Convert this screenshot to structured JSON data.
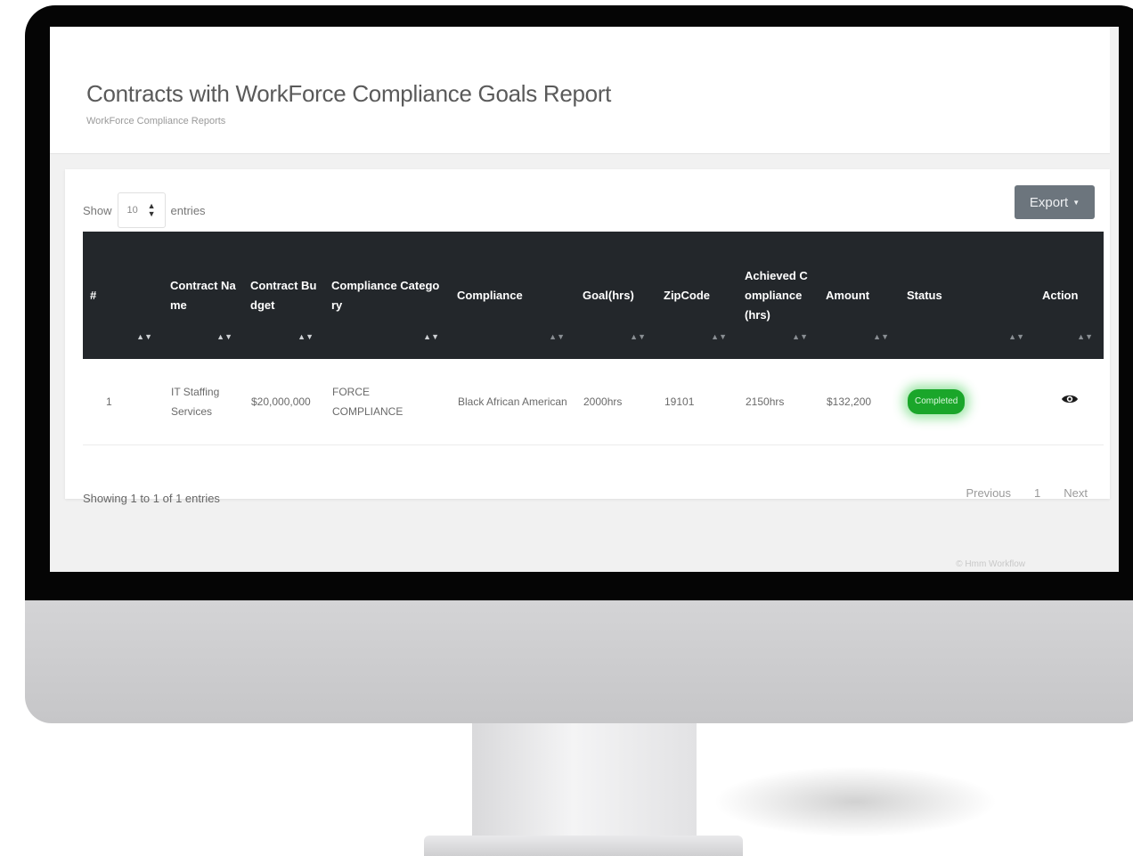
{
  "page": {
    "title": "Contracts with WorkForce Compliance Goals Report",
    "subtitle": "WorkForce Compliance Reports"
  },
  "controls": {
    "show_label": "Show",
    "length_value": "10",
    "entries_label": "entries",
    "export_label": "Export"
  },
  "table": {
    "columns": [
      "#",
      "Contract Name",
      "Contract Budget",
      "Compliance Category",
      "Compliance",
      "Goal(hrs)",
      "ZipCode",
      "Achieved Compliance (hrs)",
      "Amount",
      "Status",
      "Action"
    ],
    "rows": [
      {
        "index": "1",
        "contract_name": "IT Staffing Services",
        "contract_budget": "$20,000,000",
        "compliance_category": "FORCE COMPLIANCE",
        "compliance": "Black African American",
        "goal": "2000hrs",
        "zipcode": "19101",
        "achieved": "2150hrs",
        "amount": "$132,200",
        "status": "Completed"
      }
    ]
  },
  "footer": {
    "info": "Showing 1 to 1 of 1 entries",
    "previous": "Previous",
    "current_page": "1",
    "next": "Next",
    "credit": "© Hmm Workflow"
  },
  "colors": {
    "header_bg": "#23272b",
    "status_completed": "#1aa62a",
    "export_button": "#6c757d"
  },
  "icons": {
    "sort": "sort-arrows-icon",
    "select": "select-arrows-icon",
    "action": "eye-icon"
  }
}
